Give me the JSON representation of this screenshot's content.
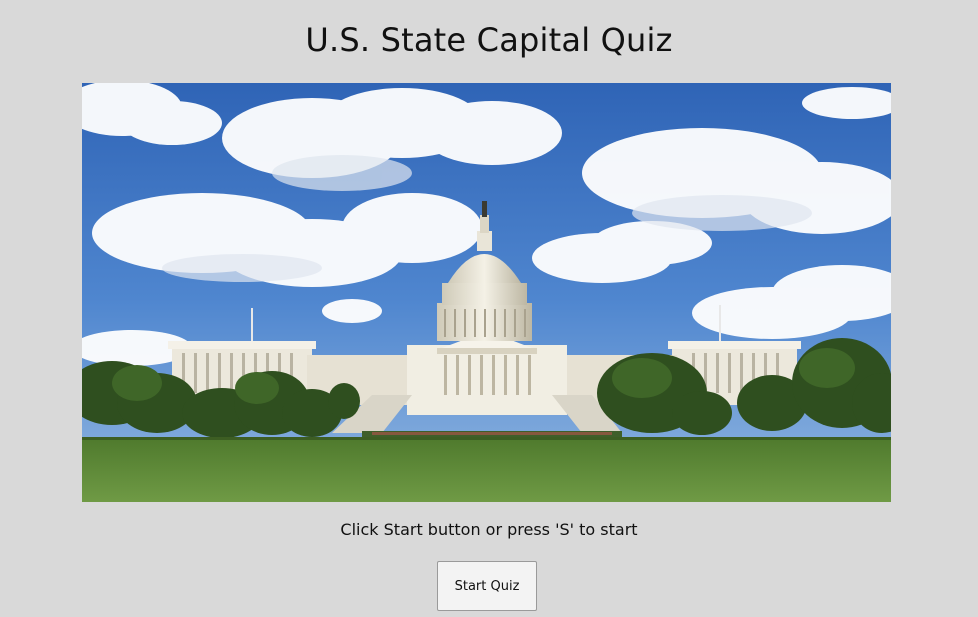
{
  "page": {
    "title": "U.S. State Capital Quiz",
    "instructions": "Click Start button or press 'S' to start"
  },
  "start_button": {
    "label": "Start Quiz"
  },
  "hero_image": {
    "subject": "capitol-building-photo"
  },
  "colors": {
    "background": "#d9d9d9",
    "sky": "#3f74c4",
    "grass": "#5f8a3a"
  }
}
